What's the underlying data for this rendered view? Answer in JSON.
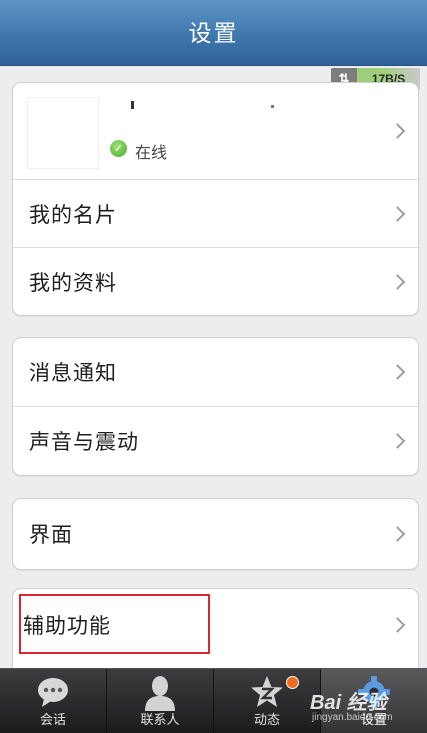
{
  "header": {
    "title": "设置"
  },
  "network": {
    "speed": "17B/S",
    "arrows": "⇅"
  },
  "profile": {
    "status": "在线"
  },
  "group1": {
    "items": [
      {
        "label": "我的名片"
      },
      {
        "label": "我的资料"
      }
    ]
  },
  "group2": {
    "items": [
      {
        "label": "消息通知"
      },
      {
        "label": "声音与震动"
      }
    ]
  },
  "group3": {
    "items": [
      {
        "label": "界面"
      }
    ]
  },
  "group4": {
    "items": [
      {
        "label": "辅助功能"
      }
    ]
  },
  "tabbar": {
    "tabs": [
      {
        "label": "会话",
        "icon": "chat-bubble-icon"
      },
      {
        "label": "联系人",
        "icon": "contact-person-icon"
      },
      {
        "label": "动态",
        "icon": "qzone-star-icon"
      },
      {
        "label": "设置",
        "icon": "gear-icon"
      }
    ]
  },
  "watermark": {
    "main": "Bai 经验",
    "sub": "jingyan.baidu.com"
  },
  "colors": {
    "header": "#3f77ad",
    "highlight": "#d9262f",
    "badge": "#f06a1d",
    "online": "#4aa92a"
  }
}
